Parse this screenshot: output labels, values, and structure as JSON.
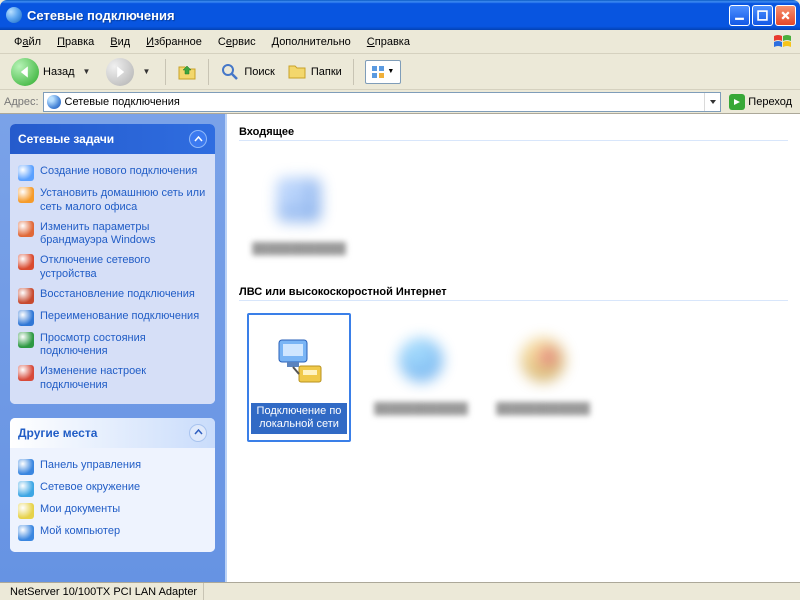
{
  "window": {
    "title": "Сетевые подключения"
  },
  "menu": {
    "items": [
      {
        "html": "Ф<u>а</u>йл"
      },
      {
        "html": "<u>П</u>равка"
      },
      {
        "html": "<u>В</u>ид"
      },
      {
        "html": "<u>И</u>збранное"
      },
      {
        "html": "С<u>е</u>рвис"
      },
      {
        "html": "<u>Д</u>ополнительно"
      },
      {
        "html": "<u>С</u>правка"
      }
    ]
  },
  "toolbar": {
    "back": "Назад",
    "search": "Поиск",
    "folders": "Папки"
  },
  "address": {
    "label": "Адрес:",
    "value": "Сетевые подключения",
    "go": "Переход"
  },
  "sidebar": {
    "tasks_title": "Сетевые задачи",
    "tasks": [
      {
        "label": "Создание нового подключения"
      },
      {
        "label": "Установить домашнюю сеть или сеть малого офиса"
      },
      {
        "label": "Изменить параметры брандмауэра Windows"
      },
      {
        "label": "Отключение сетевого устройства"
      },
      {
        "label": "Восстановление подключения"
      },
      {
        "label": "Переименование подключения"
      },
      {
        "label": "Просмотр состояния подключения"
      },
      {
        "label": "Изменение настроек подключения"
      }
    ],
    "places_title": "Другие места",
    "places": [
      {
        "label": "Панель управления"
      },
      {
        "label": "Сетевое окружение"
      },
      {
        "label": "Мои документы"
      },
      {
        "label": "Мой компьютер"
      }
    ]
  },
  "content": {
    "group1": "Входящее",
    "group2": "ЛВС или высокоскоростной Интернет",
    "selected_label": "Подключение по локальной сети"
  },
  "statusbar": {
    "text": "NetServer 10/100TX PCI LAN Adapter"
  },
  "colors": {
    "task_icons": [
      "#5aa0ff",
      "#f59b2b",
      "#e06838",
      "#d94a2f",
      "#c74a2f",
      "#3077d6",
      "#2d9942",
      "#d74a3a"
    ],
    "place_icons": [
      "#3a86e0",
      "#3da6e4",
      "#e6d24a",
      "#3a86e0"
    ]
  }
}
